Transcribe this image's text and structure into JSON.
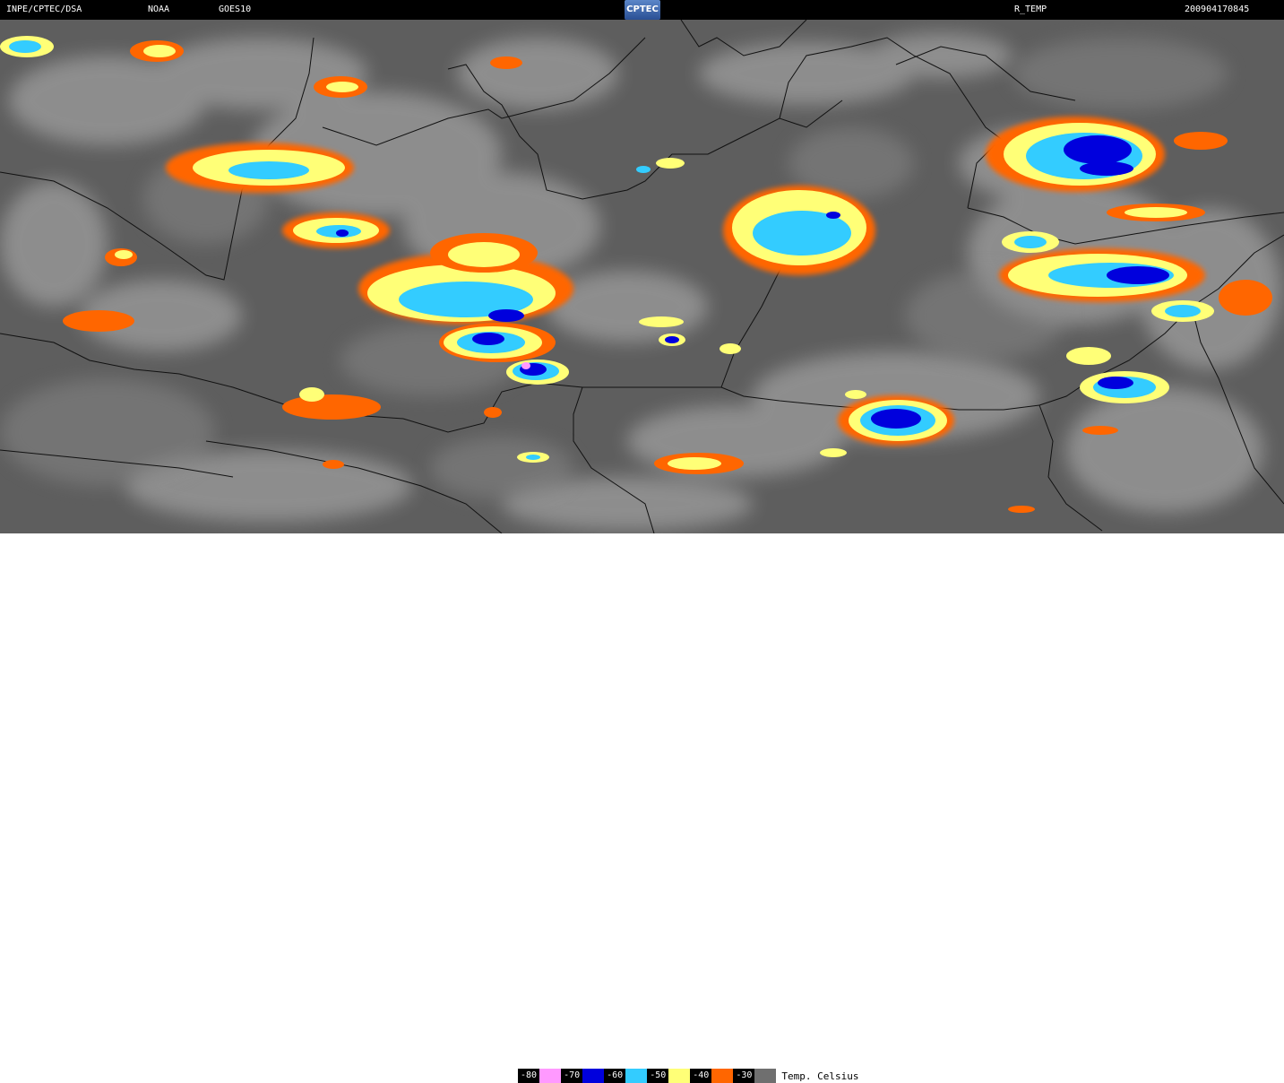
{
  "header": {
    "agency": "INPE/CPTEC/DSA",
    "source": "NOAA",
    "satellite": "GOES10",
    "logo_text": "CPTEC",
    "product": "R_TEMP",
    "timestamp": "200904170845"
  },
  "legend": {
    "title": "Temp. Celsius",
    "items": [
      {
        "label": "-80",
        "color": "#ff99ff"
      },
      {
        "label": "-70",
        "color": "#0000dd"
      },
      {
        "label": "-60",
        "color": "#33ccff"
      },
      {
        "label": "-50",
        "color": "#ffff77"
      },
      {
        "label": "-40",
        "color": "#ff6600"
      },
      {
        "label": "-30",
        "color": "#6f6f6f"
      }
    ]
  },
  "colors": {
    "background_gray": "#5e5e5e",
    "cloud_gray": "#b9b9b9",
    "border_lines": "#101010"
  }
}
